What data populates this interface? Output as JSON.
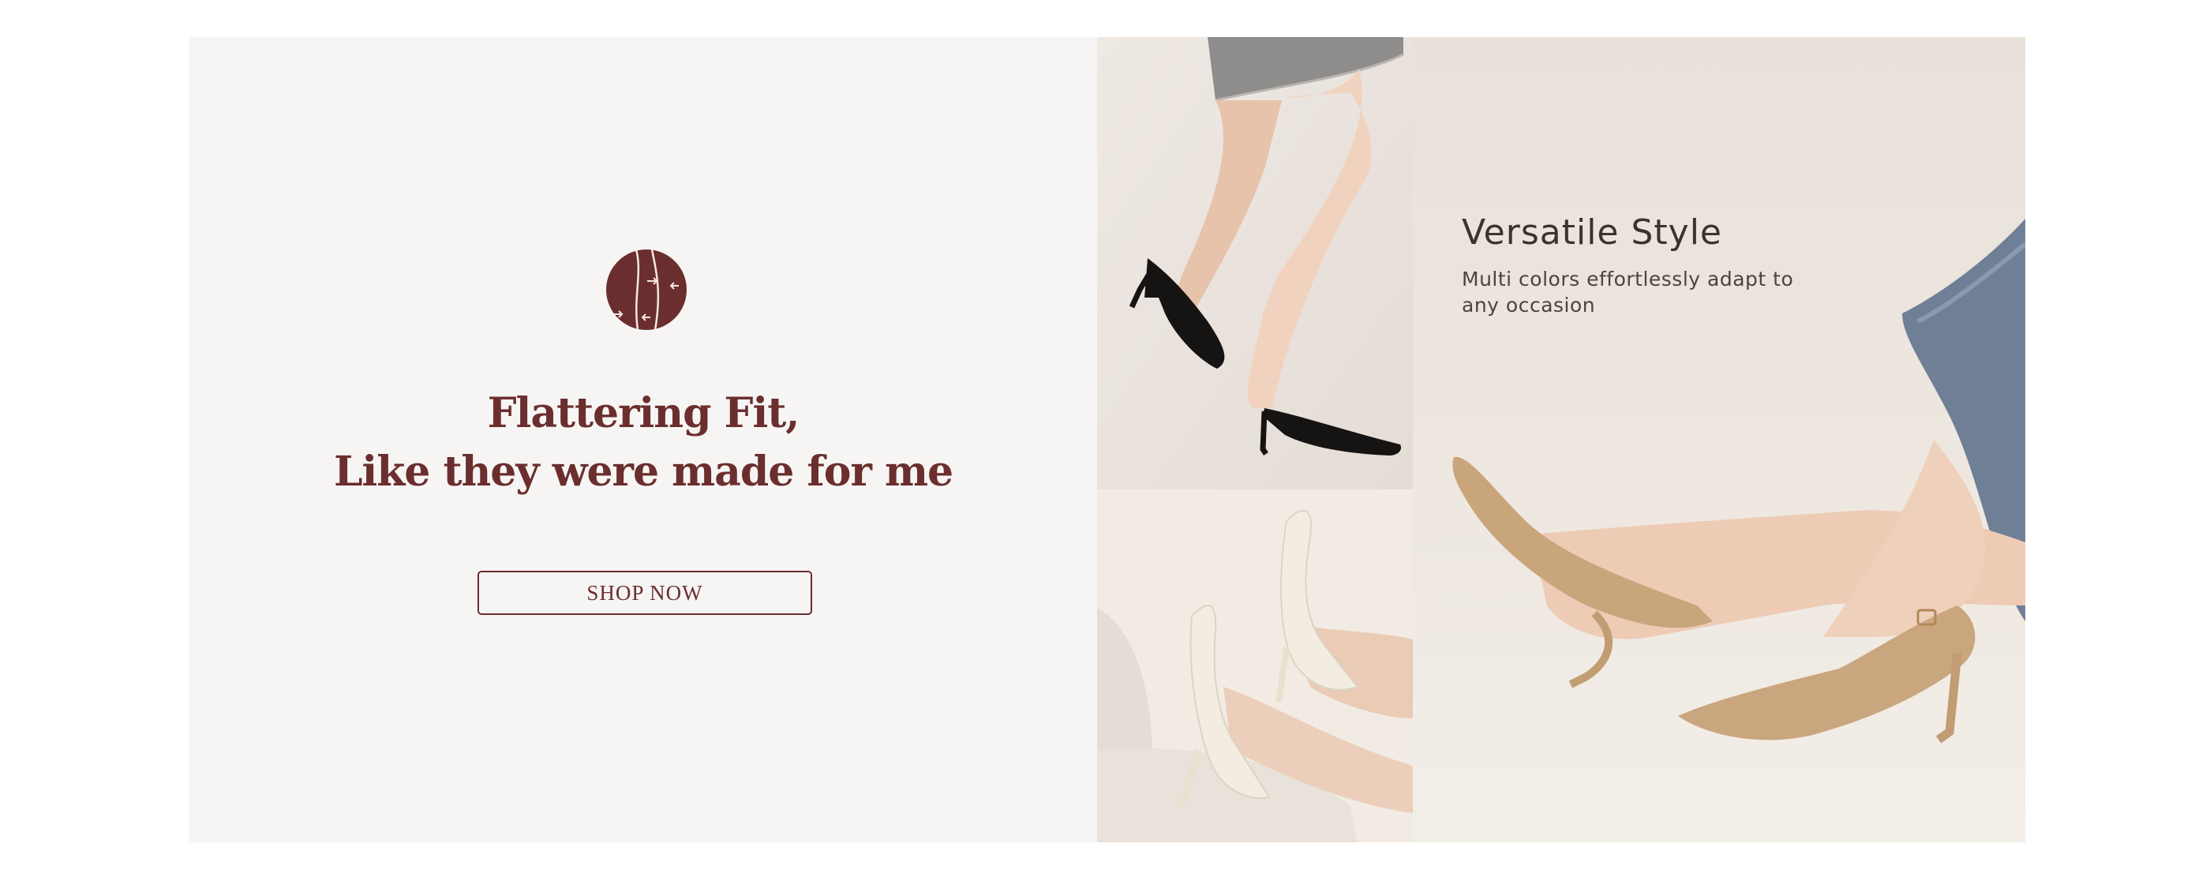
{
  "promo": {
    "icon": "leg-fit-arrows-icon",
    "headline_line1": "Flattering Fit,",
    "headline_line2": "Like they were made for me",
    "cta_label": "SHOP NOW"
  },
  "feature": {
    "title": "Versatile Style",
    "description": "Multi colors effortlessly adapt to any occasion"
  },
  "photos": {
    "top": "black-suede-slingback-heels-photo",
    "bottom": "cream-slingback-heels-photo",
    "right": "tan-knit-slingback-heels-photo"
  },
  "colors": {
    "brand": "#6b2e2e",
    "panel_bg": "#f6f5f3",
    "text_dark": "#3a3330"
  }
}
